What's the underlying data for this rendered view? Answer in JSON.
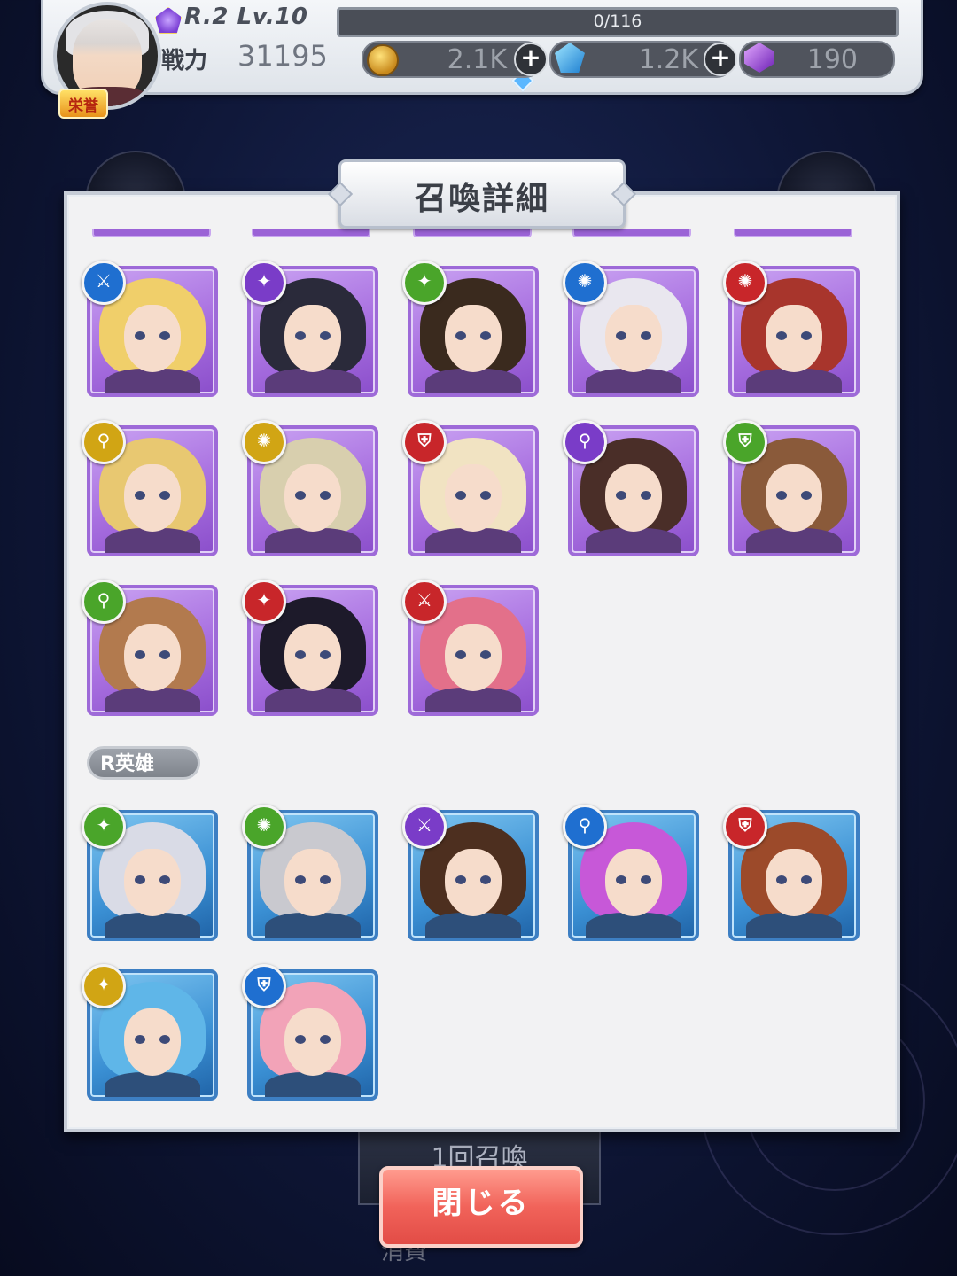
{
  "player": {
    "rank_level": "R.2 Lv.10",
    "exp": "0/116",
    "power_label": "戦力",
    "power_value": "31195",
    "honor_badge": "栄誉"
  },
  "currencies": {
    "gold": "2.1K",
    "crystal": "1.2K",
    "gem": "190"
  },
  "dialog": {
    "title": "召喚詳細",
    "r_section_label": "R英雄",
    "close_label": "閉じる"
  },
  "background": {
    "summon_button": "1回召喚",
    "cost_label": "消費"
  },
  "ssr_heroes": [
    {
      "attr_icon": "sword-icon",
      "attr_color": "#1f6fd0"
    },
    {
      "attr_icon": "wings-icon",
      "attr_color": "#7a3cc8"
    },
    {
      "attr_icon": "wings-icon",
      "attr_color": "#4aa52a"
    },
    {
      "attr_icon": "shuriken-icon",
      "attr_color": "#1f6fd0"
    },
    {
      "attr_icon": "shuriken-icon",
      "attr_color": "#c8262a"
    },
    {
      "attr_icon": "staff-icon",
      "attr_color": "#d1a514"
    },
    {
      "attr_icon": "shuriken-icon",
      "attr_color": "#d1a514"
    },
    {
      "attr_icon": "shield-icon",
      "attr_color": "#c8262a"
    },
    {
      "attr_icon": "staff-icon",
      "attr_color": "#7a3cc8"
    },
    {
      "attr_icon": "shield-icon",
      "attr_color": "#4aa52a"
    },
    {
      "attr_icon": "staff-icon",
      "attr_color": "#4aa52a"
    },
    {
      "attr_icon": "wings-icon",
      "attr_color": "#c8262a"
    },
    {
      "attr_icon": "sword-icon",
      "attr_color": "#c8262a"
    }
  ],
  "r_heroes": [
    {
      "attr_icon": "wings-icon",
      "attr_color": "#4aa52a"
    },
    {
      "attr_icon": "shuriken-icon",
      "attr_color": "#4aa52a"
    },
    {
      "attr_icon": "sword-icon",
      "attr_color": "#7a3cc8"
    },
    {
      "attr_icon": "staff-icon",
      "attr_color": "#1f6fd0"
    },
    {
      "attr_icon": "shield-icon",
      "attr_color": "#c8262a"
    },
    {
      "attr_icon": "wings-icon",
      "attr_color": "#d1a514"
    },
    {
      "attr_icon": "shield-icon",
      "attr_color": "#1f6fd0"
    }
  ]
}
